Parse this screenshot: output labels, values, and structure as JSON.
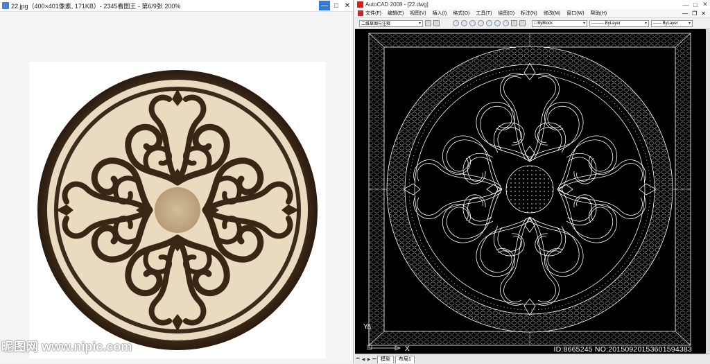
{
  "viewer": {
    "title": "22.jpg（400×401像素, 171KB）- 2345看图王 - 第6/9张 200%",
    "controls": {
      "minimize": "—",
      "maximize": "□",
      "close": "✕"
    }
  },
  "watermark": {
    "cn": "昵图网",
    "url": "www.nipic.com"
  },
  "autocad": {
    "title": "AutoCAD 2008 - [22.dwg]",
    "controls": {
      "minimize": "—",
      "maximize": "□",
      "close": "✕"
    },
    "menu": [
      "文件(F)",
      "编辑(E)",
      "视图(V)",
      "插入(I)",
      "格式(O)",
      "工具(T)",
      "绘图(D)",
      "标注(N)",
      "修改(M)",
      "窗口(W)",
      "帮助(H)"
    ],
    "menu_controls": {
      "minimize": "—",
      "restore": "❐",
      "close": "✕"
    },
    "workspace": "二维草图与注释",
    "color_combo": "ByBlock",
    "linetype_combo": "ByLayer",
    "lineweight_combo": "ByLayer",
    "ucs_y": "Y",
    "ucs_x": "X",
    "id_text": "ID:8665245 NO:20150920153601594383",
    "tabs": [
      "模型",
      "布局1"
    ]
  },
  "colors": {
    "viewer_select": "#2e7be0",
    "cad_bg": "#000000",
    "cad_lines": "#ffffff",
    "marble_dark": "#3c2a1a",
    "marble_light": "#eadbc0"
  }
}
